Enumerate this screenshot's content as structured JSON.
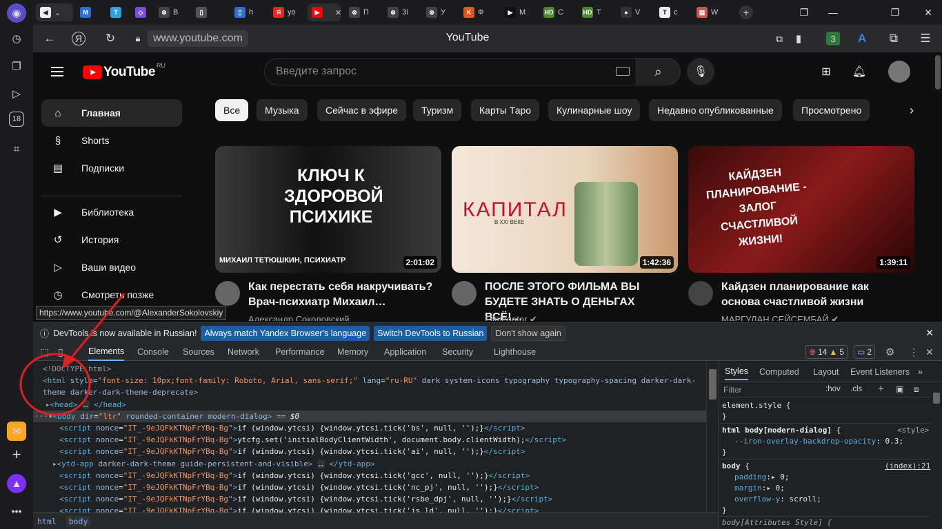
{
  "browser": {
    "rail_icons": [
      "profile-icon",
      "history-icon",
      "collections-icon",
      "video-icon",
      "age-18-icon",
      "screenshot-icon"
    ],
    "rail_bottom_icons": [
      "mail-icon",
      "add-icon",
      "alice-icon",
      "more-icon"
    ],
    "tabs": [
      {
        "label": "",
        "fav": "M",
        "color": "#2b6de0"
      },
      {
        "label": "",
        "fav": "T",
        "color": "#2aa3e0"
      },
      {
        "label": "",
        "fav": "◇",
        "color": "#7a4de0"
      },
      {
        "label": "В",
        "fav": "⊗",
        "color": "#444"
      },
      {
        "label": "",
        "fav": "▯",
        "color": "#555"
      },
      {
        "label": "h",
        "fav": "▯",
        "color": "#2f6fd6"
      },
      {
        "label": "yo",
        "fav": "Я",
        "color": "#e22"
      },
      {
        "label": "",
        "fav": "▶",
        "color": "#f00"
      },
      {
        "label": "П",
        "fav": "⊗",
        "color": "#444"
      },
      {
        "label": "Зі",
        "fav": "⊗",
        "color": "#444"
      },
      {
        "label": "У",
        "fav": "⊗",
        "color": "#444"
      },
      {
        "label": "Ф",
        "fav": "K",
        "color": "#e0561a"
      },
      {
        "label": "М",
        "fav": "▶",
        "color": "#111"
      },
      {
        "label": "С",
        "fav": "HD",
        "color": "#4a8a2a"
      },
      {
        "label": "Т",
        "fav": "HD",
        "color": "#4a8a2a"
      },
      {
        "label": "V",
        "fav": "●",
        "color": "#333"
      },
      {
        "label": "с",
        "fav": "T",
        "color": "#eee"
      },
      {
        "label": "W",
        "fav": "▤",
        "color": "#c55"
      }
    ],
    "url": "www.youtube.com",
    "page_title": "YouTube",
    "ext_badge": "3"
  },
  "youtube": {
    "logo_word": "YouTube",
    "logo_cc": "RU",
    "search_placeholder": "Введите запрос",
    "sidebar": [
      {
        "label": "Главная",
        "icon": "home-icon",
        "glyph": "⌂"
      },
      {
        "label": "Shorts",
        "icon": "shorts-icon",
        "glyph": "§"
      },
      {
        "label": "Подписки",
        "icon": "subscriptions-icon",
        "glyph": "▤"
      },
      {
        "label": "Библиотека",
        "icon": "library-icon",
        "glyph": "▶"
      },
      {
        "label": "История",
        "icon": "history-icon",
        "glyph": "↺"
      },
      {
        "label": "Ваши видео",
        "icon": "your-videos-icon",
        "glyph": "▷"
      },
      {
        "label": "Смотреть позже",
        "icon": "watch-later-icon",
        "glyph": "◷"
      }
    ],
    "chips": [
      "Все",
      "Музыка",
      "Сейчас в эфире",
      "Туризм",
      "Карты Таро",
      "Кулинарные шоу",
      "Недавно опубликованные",
      "Просмотрено"
    ],
    "videos": [
      {
        "title": "Как перестать себя накручивать? Врач-психиатр Михаил…",
        "channel": "Александр Соколовский",
        "duration": "2:01:02",
        "thumb_text": "КЛЮЧ К ЗДОРОВОЙ ПСИХИКЕ",
        "thumb_caption": "МИХАИЛ ТЕТЮШКИН, ПСИХИАТР"
      },
      {
        "title": "ПОСЛЕ ЭТОГО ФИЛЬМА ВЫ БУДЕТЕ ЗНАТЬ О ДЕНЬГАХ ВСЁ!…",
        "channel": "Filmegator ✔",
        "duration": "1:42:36",
        "thumb_text": "КАПИТАЛ",
        "thumb_caption": "В XXI ВЕКЕ"
      },
      {
        "title": "Кайдзен планирование как основа счастливой жизни",
        "channel": "МАРГУЛАН СЕЙСЕМБАЙ ✔",
        "duration": "1:39:11",
        "thumb_text": "КАЙДЗЕН ПЛАНИРОВАНИЕ - ЗАЛОГ СЧАСТЛИВОЙ ЖИЗНИ!",
        "thumb_caption": ""
      }
    ],
    "tooltip": "https://www.youtube.com/@AlexanderSokolovskiy"
  },
  "devtools": {
    "info_text": "DevTools is now available in Russian!",
    "btn_match": "Always match Yandex Browser's language",
    "btn_switch": "Switch DevTools to Russian",
    "btn_dismiss": "Don't show again",
    "tabs": [
      "Elements",
      "Console",
      "Sources",
      "Network",
      "Performance",
      "Memory",
      "Application",
      "Security",
      "Lighthouse"
    ],
    "errors": "14",
    "warnings": "5",
    "messages": "2",
    "breadcrumbs": [
      "html",
      "body"
    ],
    "styles_tabs": [
      "Styles",
      "Computed",
      "Layout",
      "Event Listeners"
    ],
    "filter_placeholder": "Filter",
    "hov": ":hov",
    "cls": ".cls"
  }
}
